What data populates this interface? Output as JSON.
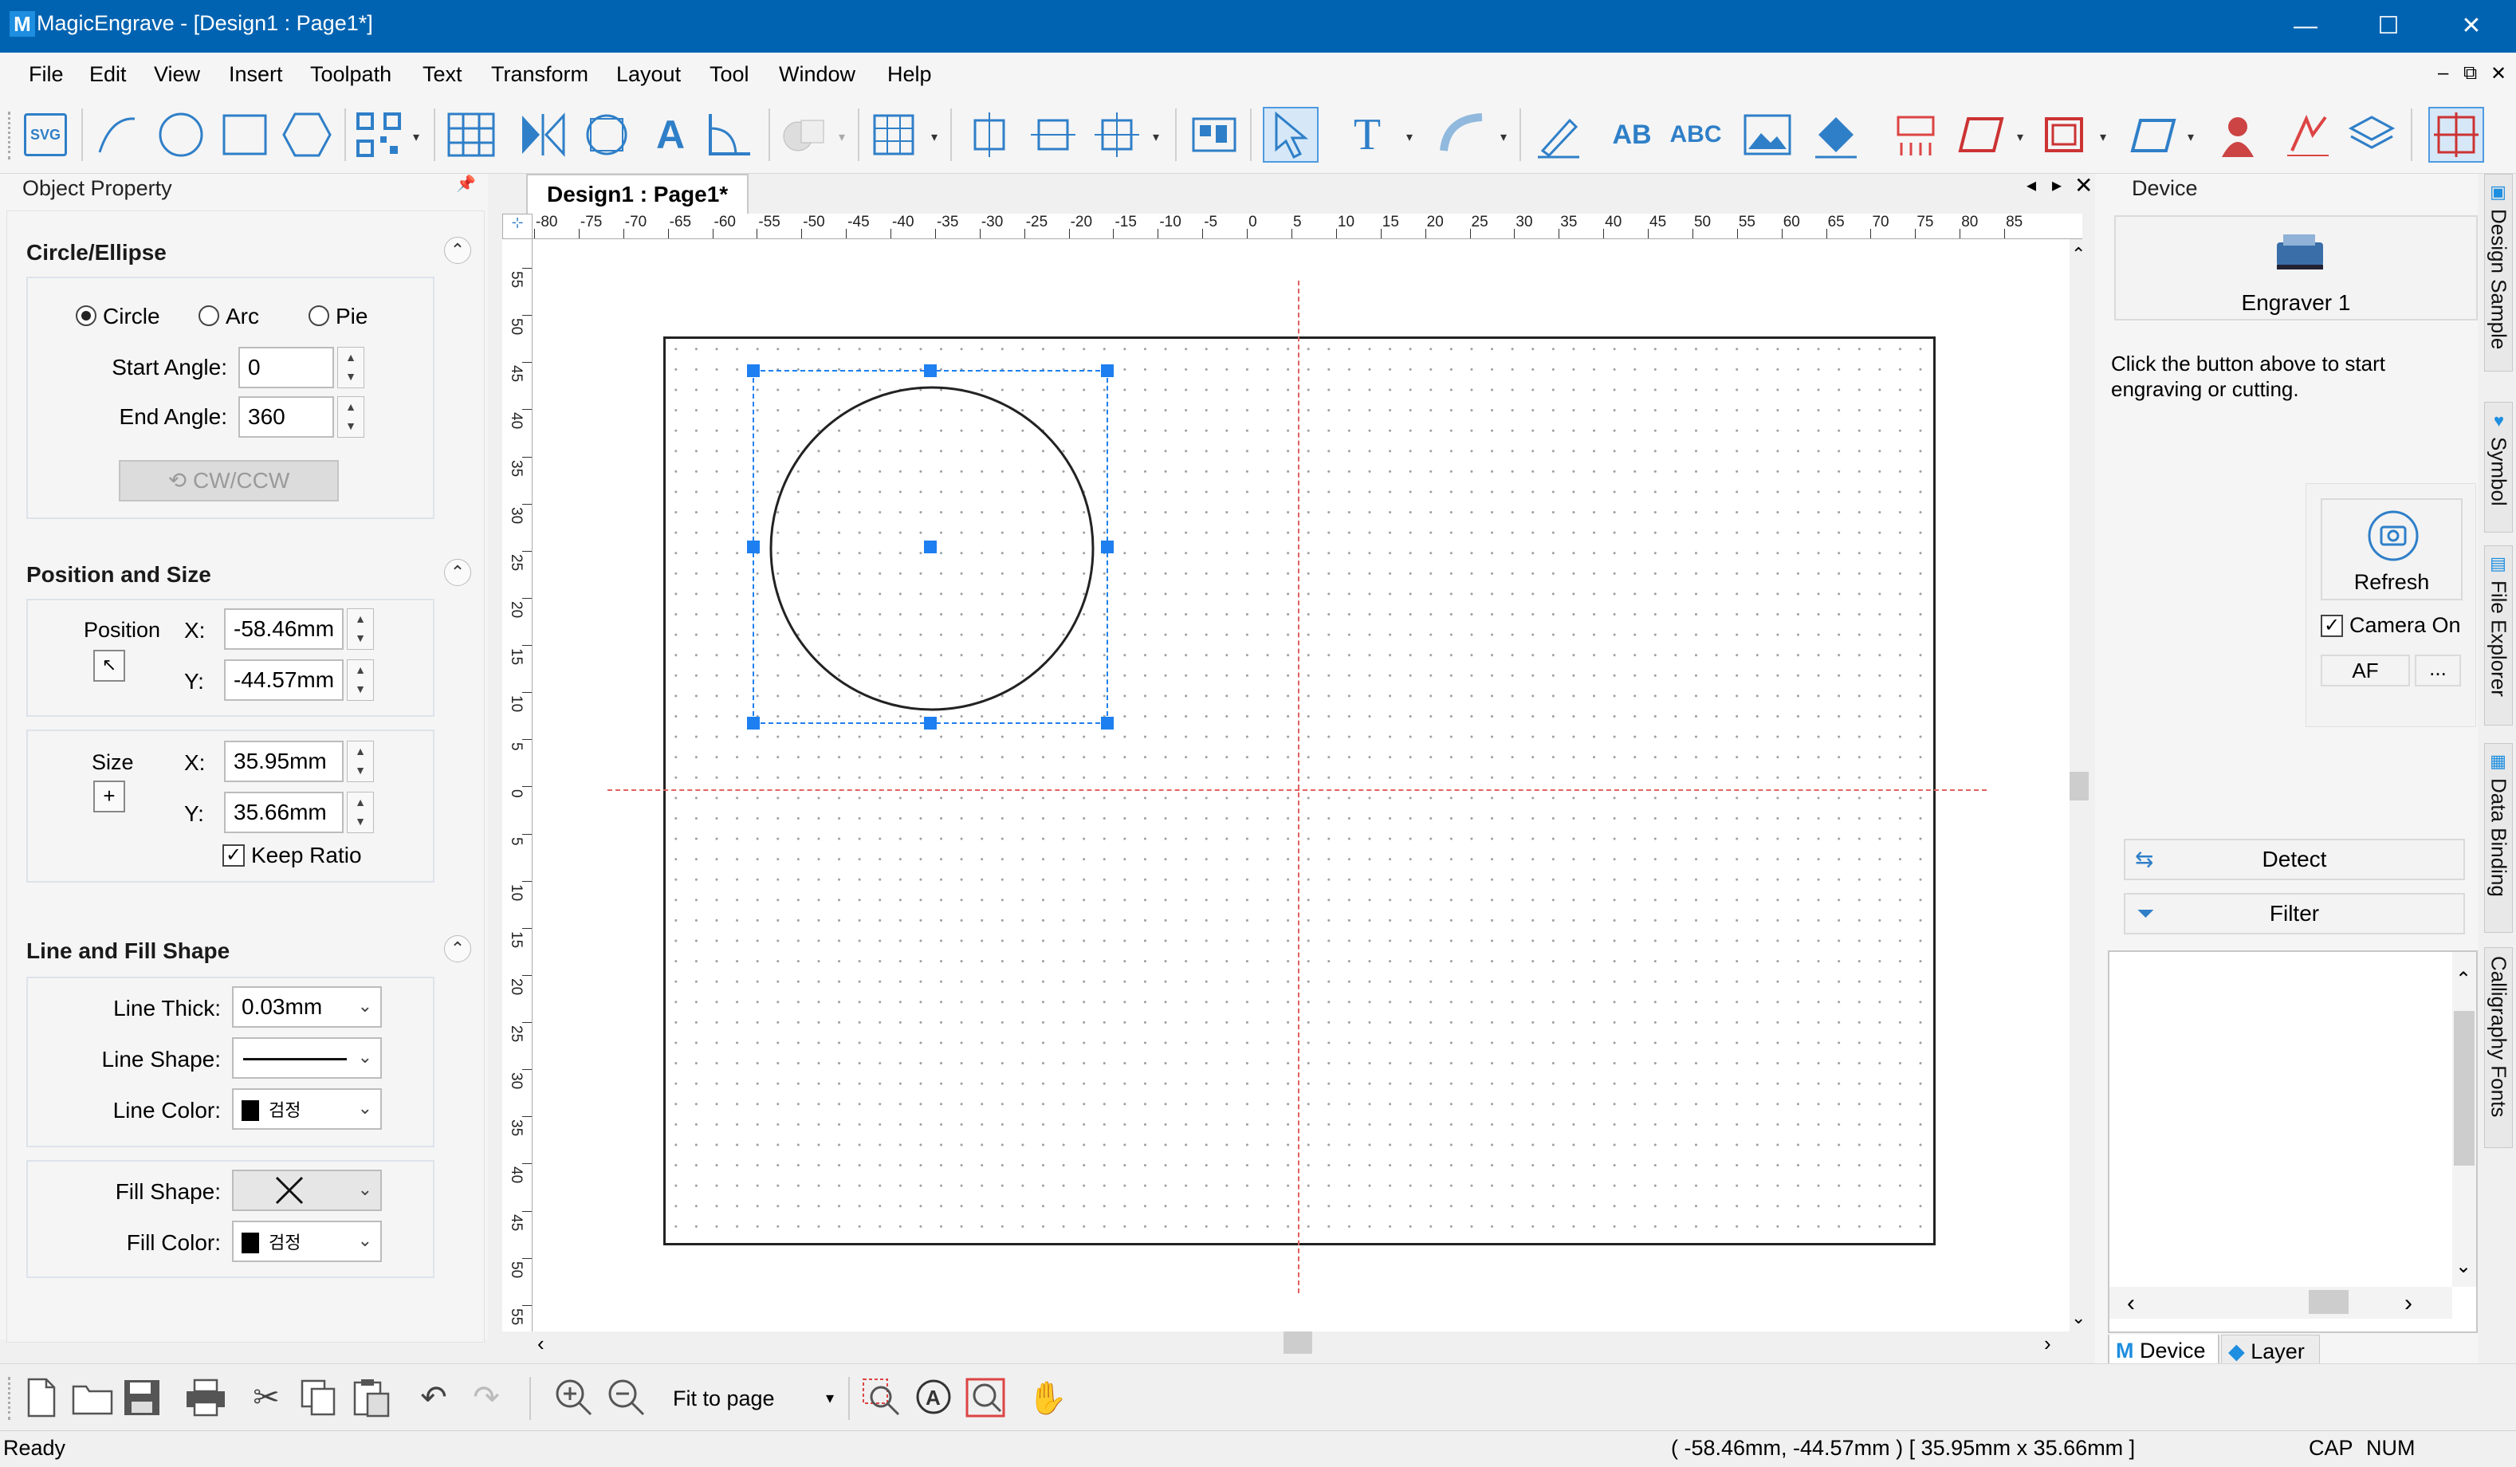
{
  "window": {
    "title": "MagicEngrave - [Design1 : Page1*]",
    "logo": "M",
    "controls": {
      "minimize": "—",
      "maximize": "☐",
      "close": "✕"
    }
  },
  "menubar": {
    "items": [
      "File",
      "Edit",
      "View",
      "Insert",
      "Toolpath",
      "Text",
      "Transform",
      "Layout",
      "Tool",
      "Window",
      "Help"
    ],
    "right_controls": [
      "–",
      "⧉",
      "✕"
    ]
  },
  "toolbar": {
    "svg_label": "SVG",
    "text_tool_glyph": "T",
    "ab_label": "AB",
    "abc_label": "ABC"
  },
  "object_property": {
    "title": "Object Property",
    "pin": "📌",
    "circle_ellipse": {
      "header": "Circle/Ellipse",
      "modes": [
        "Circle",
        "Arc",
        "Pie"
      ],
      "selected_mode": "Circle",
      "start_angle_label": "Start Angle:",
      "start_angle": "0",
      "end_angle_label": "End Angle:",
      "end_angle": "360",
      "cw_ccw": "CW/CCW"
    },
    "position_size": {
      "header": "Position and Size",
      "position_label": "Position",
      "pos_x_label": "X:",
      "pos_x": "-58.46mm",
      "pos_y_label": "Y:",
      "pos_y": "-44.57mm",
      "size_label": "Size",
      "size_x_label": "X:",
      "size_x": "35.95mm",
      "size_y_label": "Y:",
      "size_y": "35.66mm",
      "keep_ratio": "Keep Ratio",
      "keep_ratio_checked": true
    },
    "line_fill": {
      "header": "Line and Fill Shape",
      "line_thick_label": "Line Thick:",
      "line_thick": "0.03mm",
      "line_shape_label": "Line Shape:",
      "line_color_label": "Line Color:",
      "line_color": "검정",
      "fill_shape_label": "Fill Shape:",
      "fill_color_label": "Fill Color:",
      "fill_color": "검정"
    }
  },
  "document": {
    "tab": "Design1 : Page1*",
    "ruler_h": [
      "-80",
      "-75",
      "-70",
      "-65",
      "-60",
      "-55",
      "-50",
      "-45",
      "-40",
      "-35",
      "-30",
      "-25",
      "-20",
      "-15",
      "-10",
      "-5",
      "0",
      "5",
      "10",
      "15",
      "20",
      "25",
      "30",
      "35",
      "40",
      "45",
      "50",
      "55",
      "60",
      "65",
      "70",
      "75",
      "80",
      "85"
    ],
    "ruler_v": [
      "55",
      "50",
      "45",
      "40",
      "35",
      "30",
      "25",
      "20",
      "15",
      "10",
      "5",
      "0",
      "5",
      "10",
      "15",
      "20",
      "25",
      "30",
      "35",
      "40",
      "45",
      "50",
      "55"
    ]
  },
  "device": {
    "title": "Device",
    "engraver": "Engraver 1",
    "hint": "Click the button above to start engraving or cutting.",
    "refresh": "Refresh",
    "camera_on": "Camera On",
    "camera_checked": true,
    "af": "AF",
    "more": "...",
    "detect": "Detect",
    "filter": "Filter",
    "tabs": [
      "Device",
      "Layer"
    ]
  },
  "side_tabs": [
    "Design Sample",
    "Symbol",
    "File Explorer",
    "Data Binding",
    "Calligraphy Fonts"
  ],
  "bottom_toolbar": {
    "zoom_select": "Fit to page"
  },
  "status": {
    "left": "Ready",
    "coords": "( -58.46mm, -44.57mm )  [ 35.95mm x 35.66mm ]",
    "cap": "CAP",
    "num": "NUM"
  },
  "colors": {
    "titlebar": "#0063b1",
    "accent": "#1e7ff0",
    "guide": "#e06060"
  }
}
